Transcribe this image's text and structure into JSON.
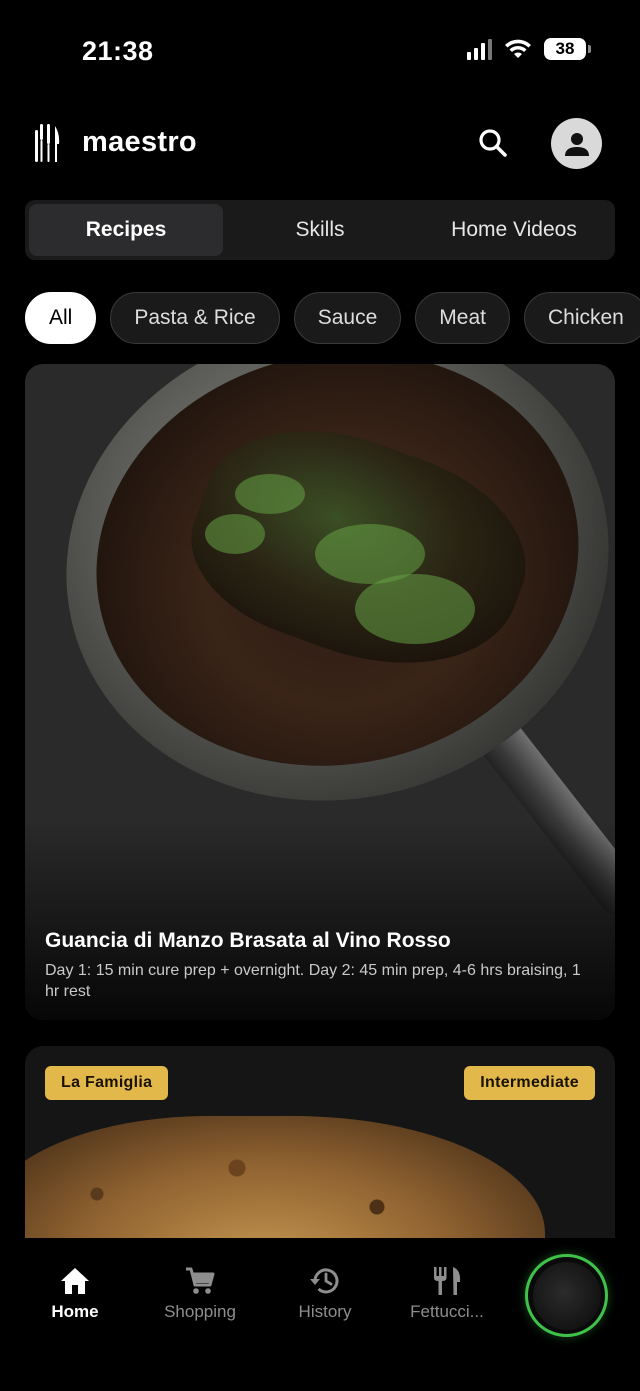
{
  "status_bar": {
    "time": "21:38",
    "battery": "38"
  },
  "header": {
    "app_name": "maestro",
    "icons": {
      "logo": "utensils-logo-icon",
      "search": "search-icon",
      "profile": "user-icon"
    }
  },
  "tabs": [
    {
      "label": "Recipes",
      "active": true
    },
    {
      "label": "Skills",
      "active": false
    },
    {
      "label": "Home Videos",
      "active": false
    }
  ],
  "categories": [
    {
      "label": "All",
      "active": true
    },
    {
      "label": "Pasta & Rice",
      "active": false
    },
    {
      "label": "Sauce",
      "active": false
    },
    {
      "label": "Meat",
      "active": false
    },
    {
      "label": "Chicken",
      "active": false
    }
  ],
  "recipes": [
    {
      "title": "Guancia di Manzo Brasata al Vino Rosso",
      "description": "Day 1: 15 min cure prep + overnight. Day 2: 45 min prep, 4-6 hrs braising, 1 hr rest"
    },
    {
      "collection_badge": "La Famiglia",
      "difficulty_badge": "Intermediate"
    }
  ],
  "bottom_nav": [
    {
      "label": "Home",
      "icon": "home-icon",
      "active": true
    },
    {
      "label": "Shopping",
      "icon": "cart-icon",
      "active": false
    },
    {
      "label": "History",
      "icon": "history-icon",
      "active": false
    },
    {
      "label": "Fettucci...",
      "icon": "fork-knife-icon",
      "active": false
    }
  ],
  "colors": {
    "background": "#000000",
    "badge": "#e3b84b",
    "active_ring": "#3fc24a"
  }
}
